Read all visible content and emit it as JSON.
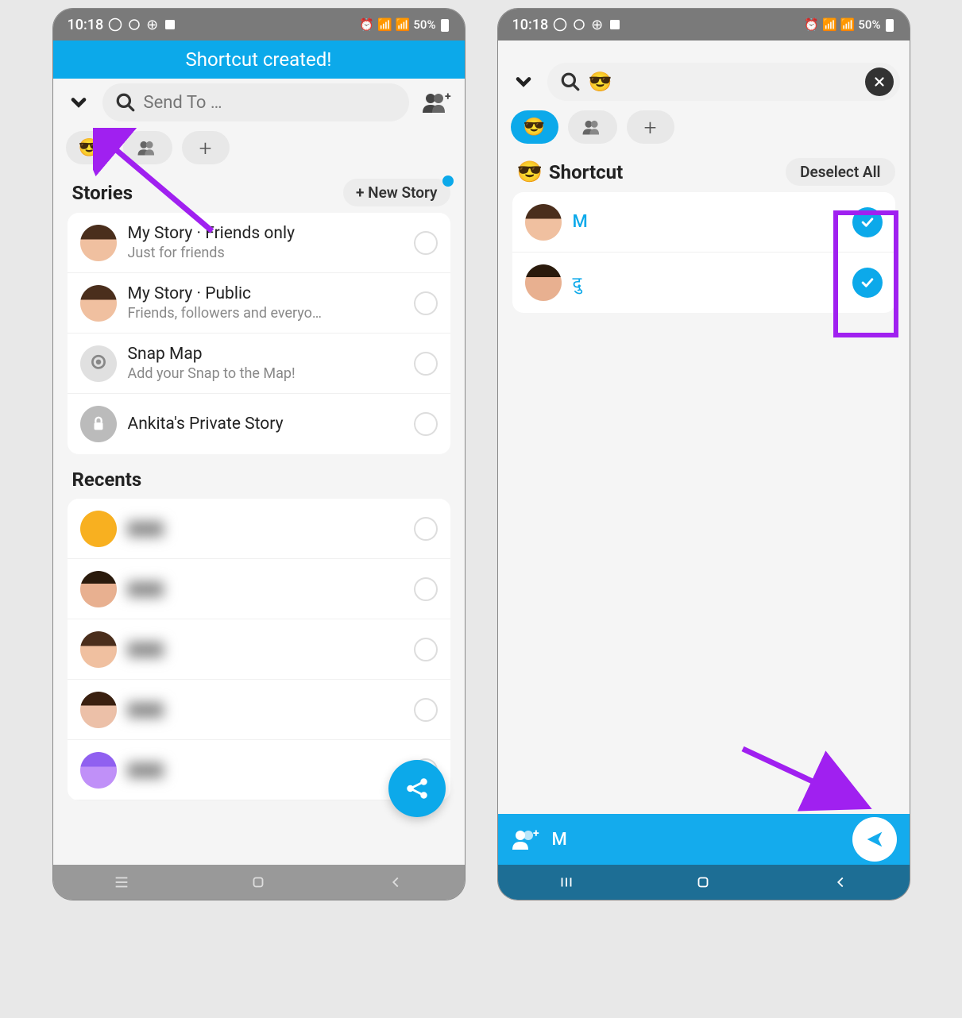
{
  "status": {
    "time": "10:18",
    "battery": "50%"
  },
  "left": {
    "banner": "Shortcut created!",
    "search_placeholder": "Send To …",
    "chip_emoji": "😎",
    "stories_title": "Stories",
    "new_story_label": "+ New Story",
    "stories": [
      {
        "title": "My Story · Friends only",
        "subtitle": "Just for friends"
      },
      {
        "title": "My Story · Public",
        "subtitle": "Friends, followers and everyo…"
      },
      {
        "title": "Snap Map",
        "subtitle": "Add your Snap to the Map!"
      },
      {
        "title": "Ankita's Private Story",
        "subtitle": ""
      }
    ],
    "recents_title": "Recents"
  },
  "right": {
    "search_value": "😎",
    "chip_active": "😎",
    "shortcut_label": "Shortcut",
    "deselect_label": "Deselect All",
    "contacts": [
      {
        "name": "M"
      },
      {
        "name": "दु"
      }
    ],
    "send_name": "M"
  }
}
